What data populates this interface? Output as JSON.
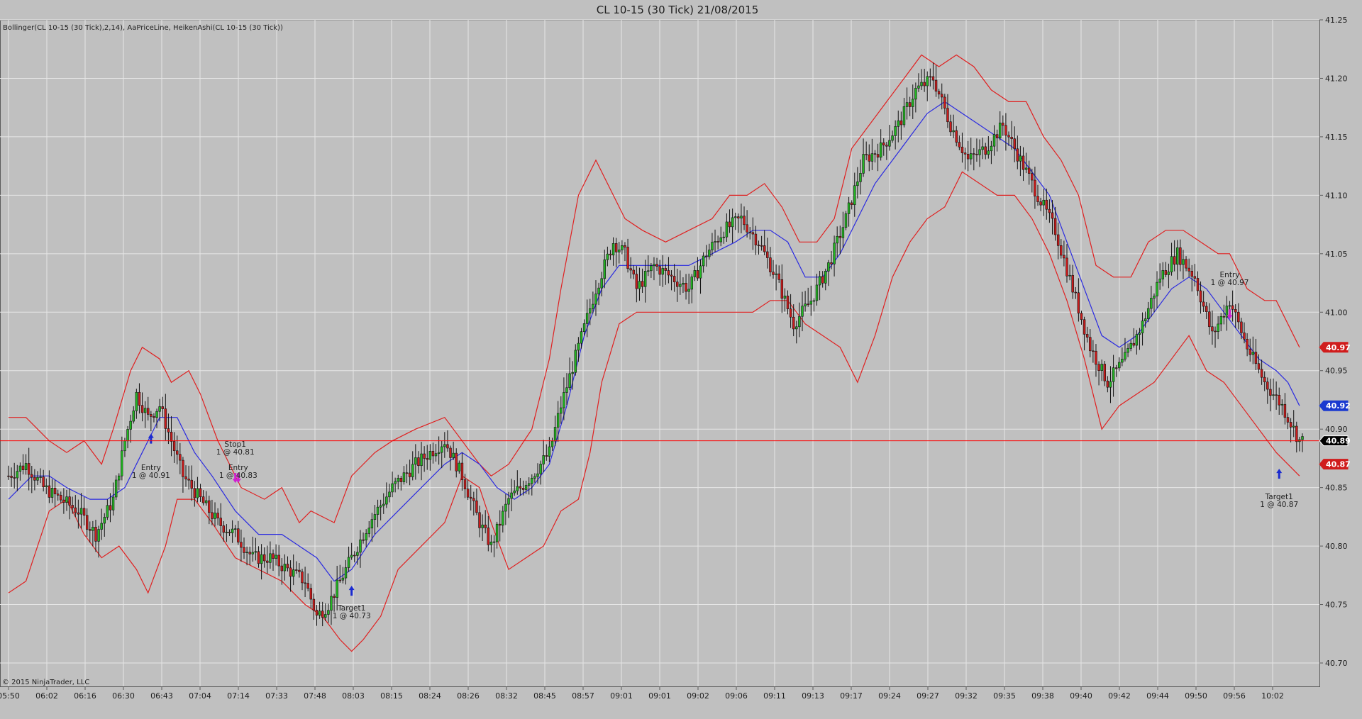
{
  "window": {
    "title": "CL 10-15 (30 Tick)  21/08/2015"
  },
  "indicator_label": "Bollinger(CL 10-15 (30 Tick),2,14), AaPriceLine, HeikenAshi(CL 10-15 (30 Tick))",
  "copyright": "© 2015 NinjaTrader, LLC",
  "colors": {
    "background": "#c0c0c0",
    "grid": "#e6e6e6",
    "bollinger_band": "#e02020",
    "bollinger_mid": "#2a2ae0",
    "bull_candle": "#22b722",
    "bear_candle": "#cc1c1c",
    "price_line": "#ff0000",
    "entry_marker": "#d020d0",
    "target_marker": "#1a2ad0"
  },
  "chart_data": {
    "type": "candlestick",
    "title": "CL 10-15 (30 Tick)  21/08/2015",
    "ylim": [
      40.68,
      41.25
    ],
    "y_ticks": [
      "41.25",
      "41.20",
      "41.15",
      "41.10",
      "41.05",
      "41.00",
      "40.95",
      "40.90",
      "40.85",
      "40.80",
      "40.75",
      "40.70"
    ],
    "x_tick_labels": [
      "05:50",
      "06:02",
      "06:16",
      "06:30",
      "06:43",
      "07:04",
      "07:14",
      "07:33",
      "07:48",
      "08:03",
      "08:15",
      "08:24",
      "08:26",
      "08:32",
      "08:45",
      "08:57",
      "09:01",
      "09:01",
      "09:02",
      "09:06",
      "09:11",
      "09:13",
      "09:17",
      "09:24",
      "09:27",
      "09:32",
      "09:35",
      "09:38",
      "09:40",
      "09:42",
      "09:44",
      "09:50",
      "09:56",
      "10:02"
    ],
    "grid": true,
    "price_line": 40.89,
    "price_badges": [
      {
        "label": "40.97",
        "value": 40.97,
        "color": "#d01c1c"
      },
      {
        "label": "40.92",
        "value": 40.92,
        "color": "#1a3ad0"
      },
      {
        "label": "40.89",
        "value": 40.89,
        "color": "#000000"
      },
      {
        "label": "40.87",
        "value": 40.87,
        "color": "#d01c1c"
      }
    ],
    "close_path": [
      [
        0,
        40.86
      ],
      [
        6,
        40.87
      ],
      [
        12,
        40.85
      ],
      [
        18,
        40.84
      ],
      [
        24,
        40.83
      ],
      [
        30,
        40.81
      ],
      [
        36,
        40.84
      ],
      [
        40,
        40.89
      ],
      [
        44,
        40.93
      ],
      [
        48,
        40.91
      ],
      [
        52,
        40.92
      ],
      [
        56,
        40.89
      ],
      [
        60,
        40.86
      ],
      [
        66,
        40.84
      ],
      [
        72,
        40.82
      ],
      [
        78,
        40.81
      ],
      [
        84,
        40.79
      ],
      [
        90,
        40.79
      ],
      [
        96,
        40.78
      ],
      [
        102,
        40.77
      ],
      [
        106,
        40.74
      ],
      [
        110,
        40.75
      ],
      [
        116,
        40.78
      ],
      [
        124,
        40.82
      ],
      [
        132,
        40.85
      ],
      [
        140,
        40.87
      ],
      [
        150,
        40.89
      ],
      [
        156,
        40.86
      ],
      [
        162,
        40.82
      ],
      [
        166,
        40.8
      ],
      [
        172,
        40.84
      ],
      [
        180,
        40.86
      ],
      [
        186,
        40.88
      ],
      [
        190,
        40.92
      ],
      [
        196,
        40.97
      ],
      [
        202,
        41.02
      ],
      [
        208,
        41.06
      ],
      [
        212,
        41.05
      ],
      [
        216,
        41.02
      ],
      [
        222,
        41.04
      ],
      [
        228,
        41.03
      ],
      [
        234,
        41.02
      ],
      [
        240,
        41.05
      ],
      [
        246,
        41.07
      ],
      [
        252,
        41.08
      ],
      [
        258,
        41.06
      ],
      [
        264,
        41.03
      ],
      [
        270,
        40.99
      ],
      [
        276,
        41.01
      ],
      [
        282,
        41.04
      ],
      [
        288,
        41.08
      ],
      [
        294,
        41.13
      ],
      [
        300,
        41.14
      ],
      [
        306,
        41.16
      ],
      [
        312,
        41.19
      ],
      [
        318,
        41.2
      ],
      [
        324,
        41.16
      ],
      [
        330,
        41.13
      ],
      [
        336,
        41.14
      ],
      [
        342,
        41.16
      ],
      [
        348,
        41.13
      ],
      [
        354,
        41.1
      ],
      [
        360,
        41.07
      ],
      [
        366,
        41.02
      ],
      [
        372,
        40.97
      ],
      [
        378,
        40.94
      ],
      [
        384,
        40.96
      ],
      [
        390,
        40.99
      ],
      [
        396,
        41.03
      ],
      [
        402,
        41.05
      ],
      [
        408,
        41.03
      ],
      [
        414,
        40.98
      ],
      [
        420,
        41.01
      ],
      [
        426,
        40.97
      ],
      [
        432,
        40.94
      ],
      [
        438,
        40.92
      ],
      [
        444,
        40.89
      ]
    ],
    "total_bars": 446,
    "bollinger_upper": [
      [
        0,
        40.91
      ],
      [
        6,
        40.91
      ],
      [
        10,
        40.9
      ],
      [
        14,
        40.89
      ],
      [
        20,
        40.88
      ],
      [
        26,
        40.89
      ],
      [
        32,
        40.87
      ],
      [
        36,
        40.9
      ],
      [
        42,
        40.95
      ],
      [
        46,
        40.97
      ],
      [
        52,
        40.96
      ],
      [
        56,
        40.94
      ],
      [
        62,
        40.95
      ],
      [
        66,
        40.93
      ],
      [
        72,
        40.89
      ],
      [
        80,
        40.85
      ],
      [
        88,
        40.84
      ],
      [
        94,
        40.85
      ],
      [
        100,
        40.82
      ],
      [
        104,
        40.83
      ],
      [
        112,
        40.82
      ],
      [
        118,
        40.86
      ],
      [
        126,
        40.88
      ],
      [
        132,
        40.89
      ],
      [
        140,
        40.9
      ],
      [
        150,
        40.91
      ],
      [
        156,
        40.89
      ],
      [
        162,
        40.87
      ],
      [
        166,
        40.86
      ],
      [
        172,
        40.87
      ],
      [
        180,
        40.9
      ],
      [
        186,
        40.96
      ],
      [
        190,
        41.02
      ],
      [
        196,
        41.1
      ],
      [
        202,
        41.13
      ],
      [
        208,
        41.1
      ],
      [
        212,
        41.08
      ],
      [
        218,
        41.07
      ],
      [
        226,
        41.06
      ],
      [
        234,
        41.07
      ],
      [
        242,
        41.08
      ],
      [
        248,
        41.1
      ],
      [
        254,
        41.1
      ],
      [
        260,
        41.11
      ],
      [
        266,
        41.09
      ],
      [
        272,
        41.06
      ],
      [
        278,
        41.06
      ],
      [
        284,
        41.08
      ],
      [
        290,
        41.14
      ],
      [
        296,
        41.16
      ],
      [
        302,
        41.18
      ],
      [
        308,
        41.2
      ],
      [
        314,
        41.22
      ],
      [
        320,
        41.21
      ],
      [
        326,
        41.22
      ],
      [
        332,
        41.21
      ],
      [
        338,
        41.19
      ],
      [
        344,
        41.18
      ],
      [
        350,
        41.18
      ],
      [
        356,
        41.15
      ],
      [
        362,
        41.13
      ],
      [
        368,
        41.1
      ],
      [
        374,
        41.04
      ],
      [
        380,
        41.03
      ],
      [
        386,
        41.03
      ],
      [
        392,
        41.06
      ],
      [
        398,
        41.07
      ],
      [
        404,
        41.07
      ],
      [
        410,
        41.06
      ],
      [
        416,
        41.05
      ],
      [
        420,
        41.05
      ],
      [
        426,
        41.02
      ],
      [
        432,
        41.01
      ],
      [
        436,
        41.01
      ],
      [
        440,
        40.99
      ],
      [
        444,
        40.97
      ]
    ],
    "bollinger_mid": [
      [
        0,
        40.84
      ],
      [
        8,
        40.86
      ],
      [
        14,
        40.86
      ],
      [
        20,
        40.85
      ],
      [
        28,
        40.84
      ],
      [
        34,
        40.84
      ],
      [
        40,
        40.85
      ],
      [
        46,
        40.88
      ],
      [
        52,
        40.91
      ],
      [
        58,
        40.91
      ],
      [
        64,
        40.88
      ],
      [
        70,
        40.86
      ],
      [
        78,
        40.83
      ],
      [
        86,
        40.81
      ],
      [
        94,
        40.81
      ],
      [
        100,
        40.8
      ],
      [
        106,
        40.79
      ],
      [
        112,
        40.77
      ],
      [
        118,
        40.78
      ],
      [
        126,
        40.81
      ],
      [
        134,
        40.83
      ],
      [
        142,
        40.85
      ],
      [
        150,
        40.87
      ],
      [
        156,
        40.88
      ],
      [
        162,
        40.87
      ],
      [
        168,
        40.85
      ],
      [
        174,
        40.84
      ],
      [
        180,
        40.85
      ],
      [
        186,
        40.87
      ],
      [
        192,
        40.92
      ],
      [
        198,
        40.98
      ],
      [
        204,
        41.02
      ],
      [
        210,
        41.04
      ],
      [
        218,
        41.04
      ],
      [
        226,
        41.04
      ],
      [
        234,
        41.04
      ],
      [
        242,
        41.05
      ],
      [
        250,
        41.06
      ],
      [
        256,
        41.07
      ],
      [
        262,
        41.07
      ],
      [
        268,
        41.06
      ],
      [
        274,
        41.03
      ],
      [
        280,
        41.03
      ],
      [
        286,
        41.05
      ],
      [
        292,
        41.08
      ],
      [
        298,
        41.11
      ],
      [
        304,
        41.13
      ],
      [
        310,
        41.15
      ],
      [
        316,
        41.17
      ],
      [
        322,
        41.18
      ],
      [
        328,
        41.17
      ],
      [
        334,
        41.16
      ],
      [
        340,
        41.15
      ],
      [
        346,
        41.14
      ],
      [
        352,
        41.12
      ],
      [
        358,
        41.1
      ],
      [
        364,
        41.06
      ],
      [
        370,
        41.02
      ],
      [
        376,
        40.98
      ],
      [
        382,
        40.97
      ],
      [
        388,
        40.98
      ],
      [
        394,
        41.0
      ],
      [
        400,
        41.02
      ],
      [
        406,
        41.03
      ],
      [
        412,
        41.02
      ],
      [
        418,
        41.0
      ],
      [
        424,
        40.98
      ],
      [
        430,
        40.96
      ],
      [
        436,
        40.95
      ],
      [
        440,
        40.94
      ],
      [
        444,
        40.92
      ]
    ],
    "bollinger_lower": [
      [
        0,
        40.76
      ],
      [
        6,
        40.77
      ],
      [
        10,
        40.8
      ],
      [
        14,
        40.83
      ],
      [
        20,
        40.84
      ],
      [
        26,
        40.81
      ],
      [
        32,
        40.79
      ],
      [
        38,
        40.8
      ],
      [
        44,
        40.78
      ],
      [
        48,
        40.76
      ],
      [
        54,
        40.8
      ],
      [
        58,
        40.84
      ],
      [
        64,
        40.84
      ],
      [
        70,
        40.82
      ],
      [
        78,
        40.79
      ],
      [
        86,
        40.78
      ],
      [
        94,
        40.77
      ],
      [
        102,
        40.75
      ],
      [
        108,
        40.74
      ],
      [
        114,
        40.72
      ],
      [
        118,
        40.71
      ],
      [
        122,
        40.72
      ],
      [
        128,
        40.74
      ],
      [
        134,
        40.78
      ],
      [
        142,
        40.8
      ],
      [
        150,
        40.82
      ],
      [
        156,
        40.86
      ],
      [
        162,
        40.85
      ],
      [
        166,
        40.82
      ],
      [
        172,
        40.78
      ],
      [
        178,
        40.79
      ],
      [
        184,
        40.8
      ],
      [
        190,
        40.83
      ],
      [
        196,
        40.84
      ],
      [
        200,
        40.88
      ],
      [
        204,
        40.94
      ],
      [
        210,
        40.99
      ],
      [
        216,
        41.0
      ],
      [
        226,
        41.0
      ],
      [
        236,
        41.0
      ],
      [
        246,
        41.0
      ],
      [
        256,
        41.0
      ],
      [
        262,
        41.01
      ],
      [
        268,
        41.01
      ],
      [
        274,
        40.99
      ],
      [
        280,
        40.98
      ],
      [
        286,
        40.97
      ],
      [
        292,
        40.94
      ],
      [
        298,
        40.98
      ],
      [
        304,
        41.03
      ],
      [
        310,
        41.06
      ],
      [
        316,
        41.08
      ],
      [
        322,
        41.09
      ],
      [
        328,
        41.12
      ],
      [
        334,
        41.11
      ],
      [
        340,
        41.1
      ],
      [
        346,
        41.1
      ],
      [
        352,
        41.08
      ],
      [
        358,
        41.05
      ],
      [
        364,
        41.01
      ],
      [
        370,
        40.96
      ],
      [
        376,
        40.9
      ],
      [
        382,
        40.92
      ],
      [
        388,
        40.93
      ],
      [
        394,
        40.94
      ],
      [
        400,
        40.96
      ],
      [
        406,
        40.98
      ],
      [
        412,
        40.95
      ],
      [
        418,
        40.94
      ],
      [
        424,
        40.92
      ],
      [
        430,
        40.9
      ],
      [
        436,
        40.88
      ],
      [
        440,
        40.87
      ],
      [
        444,
        40.86
      ]
    ],
    "annotations": [
      {
        "bar": 49,
        "value": 40.89,
        "dir": "up",
        "color": "#1a2ad0",
        "lines": [
          "Entry",
          "1 @ 40.91"
        ],
        "text_value": 40.865
      },
      {
        "bar": 78,
        "value": 40.86,
        "dir": "down",
        "color": "#d020d0",
        "lines": [
          "Stop1",
          "1 @ 40.81"
        ],
        "text_value": 40.885
      },
      {
        "bar": 79,
        "value": 40.86,
        "dir": "down",
        "color": "#d020d0",
        "lines": [
          "Entry",
          "1 @ 40.83"
        ],
        "text_value": 40.865
      },
      {
        "bar": 118,
        "value": 40.76,
        "dir": "up",
        "color": "#1a2ad0",
        "lines": [
          "Target1",
          "1 @ 40.73"
        ],
        "text_value": 40.745
      },
      {
        "bar": 420,
        "value": 41.0,
        "dir": "down",
        "color": "#d020d0",
        "lines": [
          "Entry",
          "1 @ 40.97"
        ],
        "text_value": 41.03
      },
      {
        "bar": 437,
        "value": 40.86,
        "dir": "up",
        "color": "#1a2ad0",
        "lines": [
          "Target1",
          "1 @ 40.87"
        ],
        "text_value": 40.84
      }
    ]
  }
}
